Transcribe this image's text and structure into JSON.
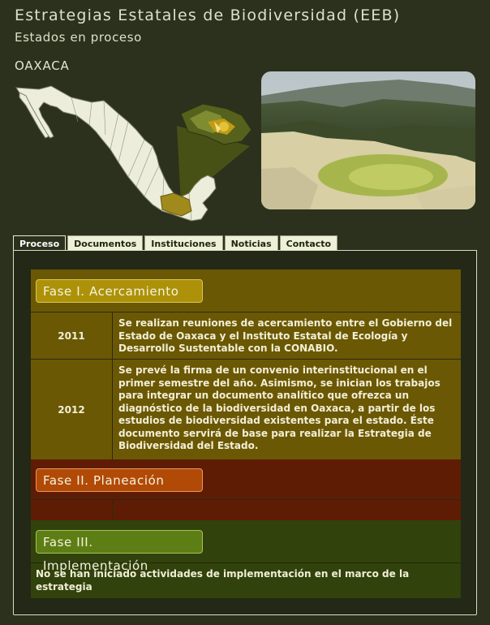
{
  "header": {
    "title": "Estrategias Estatales de Biodiversidad (EEB)",
    "subtitle": "Estados en proceso",
    "state": "OAXACA"
  },
  "tabs": [
    {
      "label": "Proceso",
      "active": true
    },
    {
      "label": "Documentos",
      "active": false
    },
    {
      "label": "Instituciones",
      "active": false
    },
    {
      "label": "Noticias",
      "active": false
    },
    {
      "label": "Contacto",
      "active": false
    }
  ],
  "phases": {
    "phase1": {
      "label": "Fase I. Acercamiento",
      "rows": [
        {
          "year": "2011",
          "text": "Se realizan reuniones de acercamiento entre el Gobierno del Estado de Oaxaca y el Instituto Estatal de Ecología y Desarrollo Sustentable con la CONABIO."
        },
        {
          "year": "2012",
          "text": "Se prevé la firma de un convenio interinstitucional en el primer semestre del año. Asimismo, se inician los trabajos para integrar un documento analítico que ofrezca un diagnóstico de la biodiversidad en Oaxaca, a partir de los estudios de biodiversidad existentes para el estado. Éste documento servirá de base para realizar la Estrategia de Biodiversidad del Estado."
        }
      ]
    },
    "phase2": {
      "label": "Fase II. Planeación",
      "rows": [
        {
          "year": "",
          "text": ""
        }
      ]
    },
    "phase3": {
      "label": "Fase III. Implementación",
      "text": "No se han iniciado actividades de implementación en el marco de la estrategia"
    }
  },
  "colors": {
    "background": "#2b311d",
    "phase1": "#ad9209",
    "phase2": "#b14a06",
    "phase3": "#5d7e14"
  }
}
